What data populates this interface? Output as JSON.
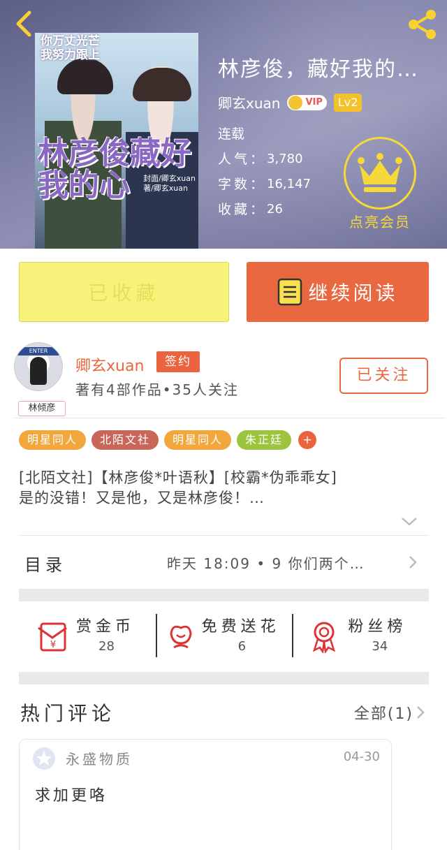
{
  "header": {
    "back_icon": "chevron-left-icon",
    "share_icon": "share-icon",
    "cover": {
      "tagline": "你万丈光芒\n我努力跟上",
      "title_art": "林彦俊藏好我的心",
      "credit": "封面/卿玄xuan\n著/卿玄xuan"
    },
    "book_title": "林彦俊，藏好我的…",
    "author": "卿玄xuan",
    "vip_label": "VIP",
    "level": "Lv2",
    "status": "连载",
    "stats": [
      {
        "key": "人气：",
        "value": "3,780"
      },
      {
        "key": "字数：",
        "value": "16,147"
      },
      {
        "key": "收藏：",
        "value": "26"
      }
    ],
    "member_icon": "crown-icon",
    "member_label": "点亮会员"
  },
  "actions": {
    "collected_label": "已收藏",
    "read_label": "继续阅读",
    "read_icon": "book-icon",
    "colors": {
      "collected_bg": "#f7f37a",
      "read_bg": "#e9683f"
    }
  },
  "author_section": {
    "avatar_sign": "ENTER",
    "avatar_tag": "林倾彦",
    "name": "卿玄xuan",
    "sign_badge": "签约",
    "info": "著有4部作品•35人关注",
    "follow_label": "已关注"
  },
  "tags": [
    {
      "label": "明星同人",
      "color": "#f2a73e"
    },
    {
      "label": "北陌文社",
      "color": "#c8665a"
    },
    {
      "label": "明星同人",
      "color": "#f2a73e"
    },
    {
      "label": "朱正廷",
      "color": "#9cc43f"
    }
  ],
  "tag_more": "+",
  "intro": {
    "line1": "[北陌文社]【林彦俊*叶语秋】[校霸*伪乖乖女]",
    "line2": "是的没错！又是他，又是林彦俊！…"
  },
  "toc": {
    "label": "目录",
    "latest": "昨天 18:09 • 9  你们两个…"
  },
  "rewards": [
    {
      "title": "赏金币",
      "count": "28",
      "icon": "red-envelope-icon"
    },
    {
      "title": "免费送花",
      "count": "6",
      "icon": "flower-icon"
    },
    {
      "title": "粉丝榜",
      "count": "34",
      "icon": "medal-icon"
    }
  ],
  "comments": {
    "title": "热门评论",
    "all_label": "全部(1)",
    "items": [
      {
        "user": "永盛物质",
        "date": "04-30",
        "text": "求加更咯",
        "avatar_icon": "star-avatar-icon"
      }
    ]
  }
}
